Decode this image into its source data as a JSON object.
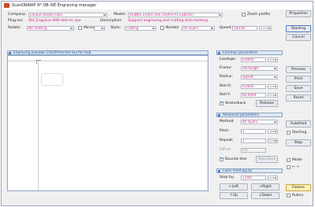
{
  "window": {
    "title": "ScanDRAWP 9* OB-ISE Engraving manager"
  },
  "header": {
    "company_label": "Company:",
    "company_value": "Lituous Studio Labs",
    "model_label": "Model:",
    "model_value": "SCBWS 14301 (S/S 1/S/P/S P1 E38192)",
    "zoom_profile_label": "Zoom profile",
    "properties_button": "Properties",
    "plug_label": "Plug-ins:",
    "plug_value": "Std_Engrave-000-ddd en spe",
    "description_label": "Description:",
    "description_value": "Support engraving and cutting and marking",
    "rotate_label": "Rotate:",
    "rotate_value": "No rotating",
    "mirror_label": "Mirror",
    "style_label": "Style:",
    "style_value": "Cutting",
    "nested_label": "Nested",
    "nested_value": "All layers",
    "speed_label": "Speed:",
    "speed_value": "100,00",
    "speed_unit": "mm/s",
    "starting_button": "Starting",
    "cancel_button": "Cancel"
  },
  "preview": {
    "header": "Engraving preview: Click/Press the key for help"
  },
  "common": {
    "header": "Common parameters",
    "leadage_label": "Leadage:",
    "leadage_value": "0,0000",
    "leadage_unit": "mm",
    "frame_label": "Frame:",
    "frame_value": "Rectangle",
    "radius_label": "Radius:",
    "radius_value": "Topleft",
    "retrx_label": "Retr-X:",
    "retrx_value": "0,0000",
    "retrx_unit": "mm",
    "retry_label": "Retr-Y:",
    "retry_value": "60,0000",
    "retry_unit": "mm",
    "autoreturn_label": "Alreterback",
    "release_button": "Release",
    "preview_button": "Preview",
    "print_button": "Print",
    "save_button": "Save",
    "reset_button": "Reset"
  },
  "advanced": {
    "header": "Advanced parameters",
    "method_label": "Method:",
    "method_value": "All layers",
    "pitch_label": "Pitch:",
    "pitch_value": "1",
    "pitch_unit": "steps",
    "repeat_label": "Repeat:",
    "repeat_value": "1",
    "repeat_unit": "times",
    "offset_label": "Offset:",
    "offset_value": "0%",
    "bounds_label": "Bounds ther",
    "test_button": "Test Zone",
    "autofeed_button": "Autofeed",
    "starting_label": "Starting",
    "stop_button": "Stop"
  },
  "laser": {
    "header": "Laser head jog by",
    "step_label": "Step by:",
    "step_value": "1,000",
    "step_unit": "mm",
    "left_button": "Left",
    "right_button": "Right",
    "up_button": "Up",
    "down_button": "Down",
    "mode_label": "Mode",
    "arrows_label": "← →",
    "fixture_button": "Fixture",
    "rulers_label": "Rulers"
  },
  "colors": {
    "accent": "#d01a8a",
    "section": "#1a4f94"
  }
}
